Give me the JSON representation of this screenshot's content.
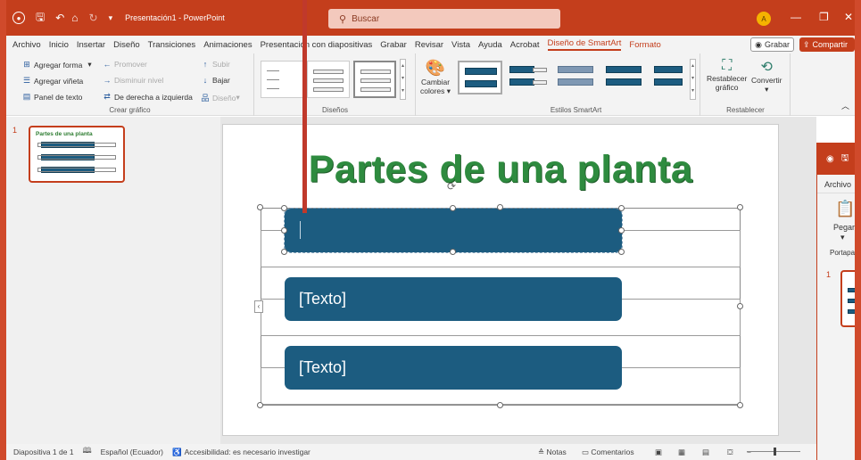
{
  "titlebar": {
    "app_icon": "powerpoint-icon",
    "title": "Presentación1 - PowerPoint",
    "search_placeholder": "Buscar",
    "avatar_initial": "A"
  },
  "menu": {
    "items": [
      "Archivo",
      "Inicio",
      "Insertar",
      "Diseño",
      "Transiciones",
      "Animaciones",
      "Presentación con diapositivas",
      "Grabar",
      "Revisar",
      "Vista",
      "Ayuda",
      "Acrobat",
      "Diseño de SmartArt",
      "Formato"
    ],
    "grabar_button": "Grabar",
    "share_button": "Compartir"
  },
  "ribbon": {
    "crear_grafico": {
      "label": "Crear gráfico",
      "agregar_forma": "Agregar forma",
      "agregar_vineta": "Agregar viñeta",
      "panel_texto": "Panel de texto",
      "promover": "Promover",
      "disminuir_nivel": "Disminuir nivel",
      "derecha_izquierda": "De derecha a izquierda",
      "subir": "Subir",
      "bajar": "Bajar",
      "diseno": "Diseño"
    },
    "disenos": {
      "label": "Diseños"
    },
    "cambiar_colores": {
      "line1": "Cambiar",
      "line2": "colores"
    },
    "estilos": {
      "label": "Estilos SmartArt"
    },
    "restablecer": {
      "label": "Restablecer",
      "restablecer_line1": "Restablecer",
      "restablecer_line2": "gráfico",
      "convertir": "Convertir"
    }
  },
  "slides_panel": {
    "slide_number": "1",
    "thumb_title": "Partes de una planta"
  },
  "slide": {
    "title": "Partes de una planta",
    "items": [
      "",
      "[Texto]",
      "[Texto]"
    ]
  },
  "right_window": {
    "tab": "Archivo",
    "pegar": "Pegar",
    "portapapeles": "Portapap",
    "slide_number": "1"
  },
  "status": {
    "slide_info": "Diapositiva 1 de 1",
    "language": "Español (Ecuador)",
    "accessibility": "Accesibilidad: es necesario investigar",
    "notes": "Notas",
    "comments": "Comentarios"
  },
  "colors": {
    "accent": "#c43e1c",
    "smartart_fill": "#1c5c80",
    "title_green": "#2e8b3f"
  }
}
